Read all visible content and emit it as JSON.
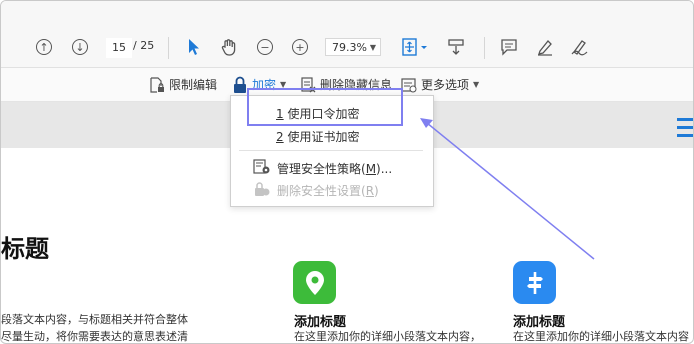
{
  "toolbar": {
    "page_current": "15",
    "page_total": "/ 25",
    "zoom": "79.3%",
    "icons": [
      "arrow-up-circle-icon",
      "arrow-down-circle-icon",
      "select-arrow-icon",
      "hand-icon",
      "zoom-out-icon",
      "zoom-in-icon",
      "fit-page-icon",
      "scroll-mode-icon",
      "comment-icon",
      "highlight-pen-icon",
      "sign-icon"
    ]
  },
  "protect_bar": {
    "restrict_edit": "限制编辑",
    "encrypt": "加密",
    "remove_hidden": "删除隐藏信息",
    "more_options": "更多选项"
  },
  "encrypt_menu": {
    "items": [
      {
        "key": "1",
        "label": " 使用口令加密",
        "enabled": true
      },
      {
        "key": "2",
        "label": " 使用证书加密",
        "enabled": true
      },
      {
        "label": "管理安全性策略(",
        "key": "M",
        "suffix": ")...",
        "enabled": true
      },
      {
        "label": "删除安全性设置(",
        "key": "R",
        "suffix": ")",
        "enabled": false
      }
    ]
  },
  "document": {
    "heading": "标题",
    "para_line1": "段落文本内容，与标题相关并符合整体",
    "para_line2": "尽量生动，将你需要表达的意思表述清",
    "cards": [
      {
        "title": "添加标题",
        "desc": "在这里添加你的详细小段落文本内容，",
        "icon_color": "#3dbb3a",
        "icon": "location-pin-icon"
      },
      {
        "title": "添加标题",
        "desc": "在这里添加你的详细小段落文本内容",
        "icon_color": "#2a8af0",
        "icon": "signpost-icon"
      }
    ]
  },
  "colors": {
    "accent_blue": "#1e7ad7",
    "annotation": "#7f7ff0"
  }
}
